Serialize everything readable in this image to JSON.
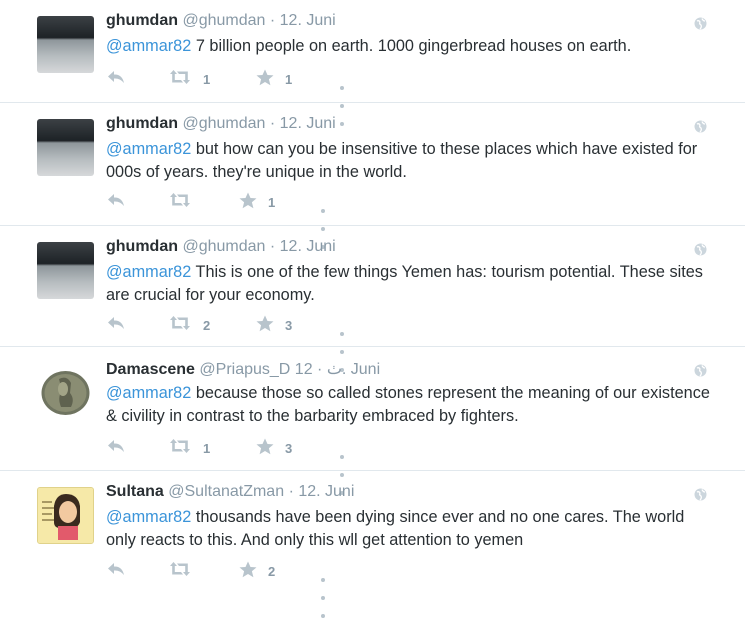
{
  "tweets": [
    {
      "name": "ghumdan",
      "handle": "@ghumdan",
      "separator": "·",
      "time": "12. Juni",
      "mention": "@ammar82",
      "text": " 7 billion people on earth. 1000 gingerbread houses on earth.",
      "retweets": "1",
      "favorites": "1",
      "avatar_type": "photo-gray"
    },
    {
      "name": "ghumdan",
      "handle": "@ghumdan",
      "separator": "·",
      "time": "12. Juni",
      "mention": "@ammar82",
      "text": " but how can you be insensitive to these places which have existed for 000s of years. they're unique in the world.",
      "retweets": "",
      "favorites": "1",
      "avatar_type": "photo-gray"
    },
    {
      "name": "ghumdan",
      "handle": "@ghumdan",
      "separator": "·",
      "time": "12. Juni",
      "mention": "@ammar82",
      "text": " This is one of the few things Yemen has: tourism potential. These sites are crucial for your economy.",
      "retweets": "2",
      "favorites": "3",
      "avatar_type": "photo-gray"
    },
    {
      "name": "Damascene",
      "handle": "@Priapus_D ٺ",
      "separator": "·",
      "time": "12. Juni",
      "mention": "@ammar82",
      "text": " because those so called stones represent the meaning of our existence & civility in contrast to the barbarity embraced by fighters.",
      "retweets": "1",
      "favorites": "3",
      "avatar_type": "coin"
    },
    {
      "name": "Sultana",
      "handle": "@SultanatZman",
      "separator": "·",
      "time": "12. Juni",
      "mention": "@ammar82",
      "text": " thousands have been dying since ever and no one cares. The world only reacts to this. And only this wll get attention to yemen",
      "retweets": "",
      "favorites": "2",
      "avatar_type": "cartoon"
    }
  ],
  "colors": {
    "accent": "#3b94d9",
    "muted": "#8899a6",
    "icon": "#b8c4cc",
    "divider": "#e1e8ed"
  },
  "icons": [
    "reply-icon",
    "retweet-icon",
    "favorite-icon",
    "more-icon",
    "globe-icon"
  ]
}
